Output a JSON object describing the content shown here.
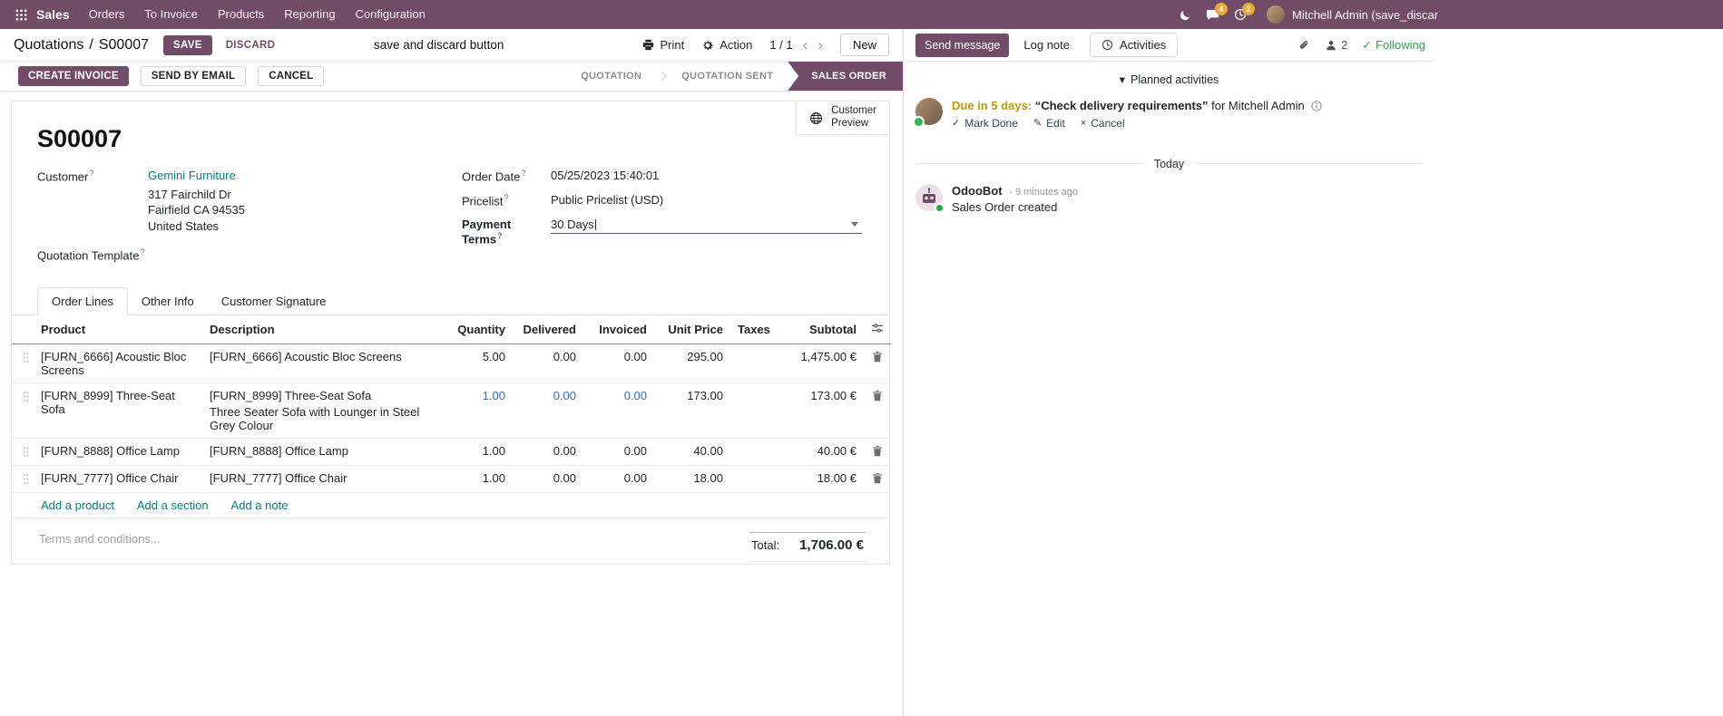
{
  "colors": {
    "primary": "#714B67",
    "link": "#017E84",
    "edited_blue": "#2B6CD4",
    "due_gold": "#C7950C",
    "success_green": "#28A745",
    "badge_orange": "#EAA839"
  },
  "glyphs": {
    "check": "✓",
    "pencil": "✎",
    "times": "×",
    "caret_down": "▾",
    "chevron_left": "‹",
    "chevron_right": "›"
  },
  "nav": {
    "app_name": "Sales",
    "menus": [
      "Orders",
      "To Invoice",
      "Products",
      "Reporting",
      "Configuration"
    ],
    "messages_badge": "4",
    "activities_badge": "2",
    "user_name": "Mitchell Admin (save_discar"
  },
  "control_panel": {
    "breadcrumb_parent": "Quotations",
    "breadcrumb_sep": "/",
    "breadcrumb_current": "S00007",
    "save": "SAVE",
    "discard": "DISCARD",
    "annotation": "save and discard button",
    "print": "Print",
    "action": "Action",
    "pager": "1 / 1",
    "new": "New"
  },
  "statusbar": {
    "create_invoice": "CREATE INVOICE",
    "send_by_email": "SEND BY EMAIL",
    "cancel": "CANCEL",
    "stages": [
      "QUOTATION",
      "QUOTATION SENT",
      "SALES ORDER"
    ]
  },
  "sheet": {
    "customer_preview_line1": "Customer",
    "customer_preview_line2": "Preview",
    "doc_name": "S00007",
    "help_marker": "?",
    "customer_label": "Customer",
    "customer_value": "Gemini Furniture",
    "address": [
      "317 Fairchild Dr",
      "Fairfield CA 94535",
      "United States"
    ],
    "quotation_template_label": "Quotation Template",
    "order_date_label": "Order Date",
    "order_date_value": "05/25/2023 15:40:01",
    "pricelist_label": "Pricelist",
    "pricelist_value": "Public Pricelist (USD)",
    "payment_terms_label": "Payment Terms",
    "payment_terms_value": "30 Days",
    "tabs": [
      "Order Lines",
      "Other Info",
      "Customer Signature"
    ],
    "table": {
      "headers": [
        "Product",
        "Description",
        "Quantity",
        "Delivered",
        "Invoiced",
        "Unit Price",
        "Taxes",
        "Subtotal"
      ],
      "rows": [
        {
          "product": "[FURN_6666] Acoustic Bloc Screens",
          "description": "[FURN_6666] Acoustic Bloc Screens",
          "description2": "",
          "quantity": "5.00",
          "delivered": "0.00",
          "invoiced": "0.00",
          "unit_price": "295.00",
          "taxes": "",
          "subtotal": "1,475.00 €"
        },
        {
          "product": "[FURN_8999] Three-Seat Sofa",
          "description": "[FURN_8999] Three-Seat Sofa",
          "description2": "Three Seater Sofa with Lounger in Steel Grey Colour",
          "quantity": "1.00",
          "delivered": "0.00",
          "invoiced": "0.00",
          "unit_price": "173.00",
          "taxes": "",
          "subtotal": "173.00 €"
        },
        {
          "product": "[FURN_8888] Office Lamp",
          "description": "[FURN_8888] Office Lamp",
          "description2": "",
          "quantity": "1.00",
          "delivered": "0.00",
          "invoiced": "0.00",
          "unit_price": "40.00",
          "taxes": "",
          "subtotal": "40.00 €"
        },
        {
          "product": "[FURN_7777] Office Chair",
          "description": "[FURN_7777] Office Chair",
          "description2": "",
          "quantity": "1.00",
          "delivered": "0.00",
          "invoiced": "0.00",
          "unit_price": "18.00",
          "taxes": "",
          "subtotal": "18.00 €"
        }
      ],
      "add_product": "Add a product",
      "add_section": "Add a section",
      "add_note": "Add a note"
    },
    "terms_placeholder": "Terms and conditions...",
    "total_label": "Total:",
    "total_value": "1,706.00 €"
  },
  "chatter": {
    "send_message": "Send message",
    "log_note": "Log note",
    "activities": "Activities",
    "followers_count": "2",
    "following": "Following",
    "planned_activities": "Planned activities",
    "activity_due": "Due in 5 days:",
    "activity_summary": "“Check delivery requirements”",
    "activity_for": "for Mitchell Admin",
    "mark_done": "Mark Done",
    "edit": "Edit",
    "cancel": "Cancel",
    "date_divider": "Today",
    "author": "OdooBot",
    "timestamp": "- 9 minutes ago",
    "message_body": "Sales Order created"
  }
}
